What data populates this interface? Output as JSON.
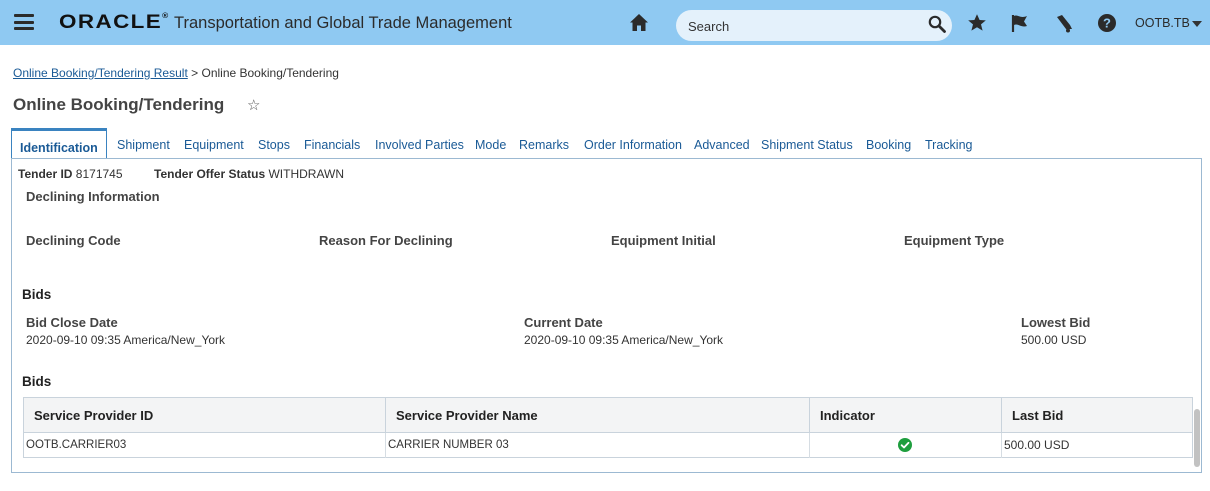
{
  "header": {
    "logo_text": "ORACLE",
    "app_title": "Transportation and Global Trade Management",
    "search_placeholder": "Search",
    "user": "OOTB.TB"
  },
  "breadcrumb": {
    "link": "Online Booking/Tendering Result",
    "separator": ">",
    "current": "Online Booking/Tendering"
  },
  "page_title": "Online Booking/Tendering",
  "tabs": [
    {
      "label": "Identification",
      "active": true
    },
    {
      "label": "Shipment"
    },
    {
      "label": "Equipment"
    },
    {
      "label": "Stops"
    },
    {
      "label": "Financials"
    },
    {
      "label": "Involved Parties"
    },
    {
      "label": "Mode"
    },
    {
      "label": "Remarks"
    },
    {
      "label": "Order Information"
    },
    {
      "label": "Advanced"
    },
    {
      "label": "Shipment Status"
    },
    {
      "label": "Booking"
    },
    {
      "label": "Tracking"
    }
  ],
  "summary": {
    "tender_id_label": "Tender ID",
    "tender_id": "8171745",
    "status_label": "Tender Offer Status",
    "status": "WITHDRAWN"
  },
  "declining": {
    "title": "Declining Information",
    "code_label": "Declining Code",
    "reason_label": "Reason For Declining",
    "equipment_initial_label": "Equipment Initial",
    "equipment_type_label": "Equipment Type"
  },
  "bids_info": {
    "title": "Bids",
    "close_date_label": "Bid Close Date",
    "close_date": "2020-09-10 09:35 America/New_York",
    "current_date_label": "Current Date",
    "current_date": "2020-09-10 09:35 America/New_York",
    "lowest_bid_label": "Lowest Bid",
    "lowest_bid": "500.00 USD"
  },
  "bids_table": {
    "title": "Bids",
    "columns": [
      "Service Provider ID",
      "Service Provider Name",
      "Indicator",
      "Last Bid"
    ],
    "rows": [
      {
        "provider_id": "OOTB.CARRIER03",
        "provider_name": "CARRIER NUMBER 03",
        "indicator": "check-icon",
        "last_bid": "500.00 USD"
      }
    ]
  },
  "colors": {
    "header_bg": "#8fc9f2",
    "link": "#1a5a96",
    "accent": "#3a83c0",
    "indicator_ok": "#1e9e3e"
  }
}
